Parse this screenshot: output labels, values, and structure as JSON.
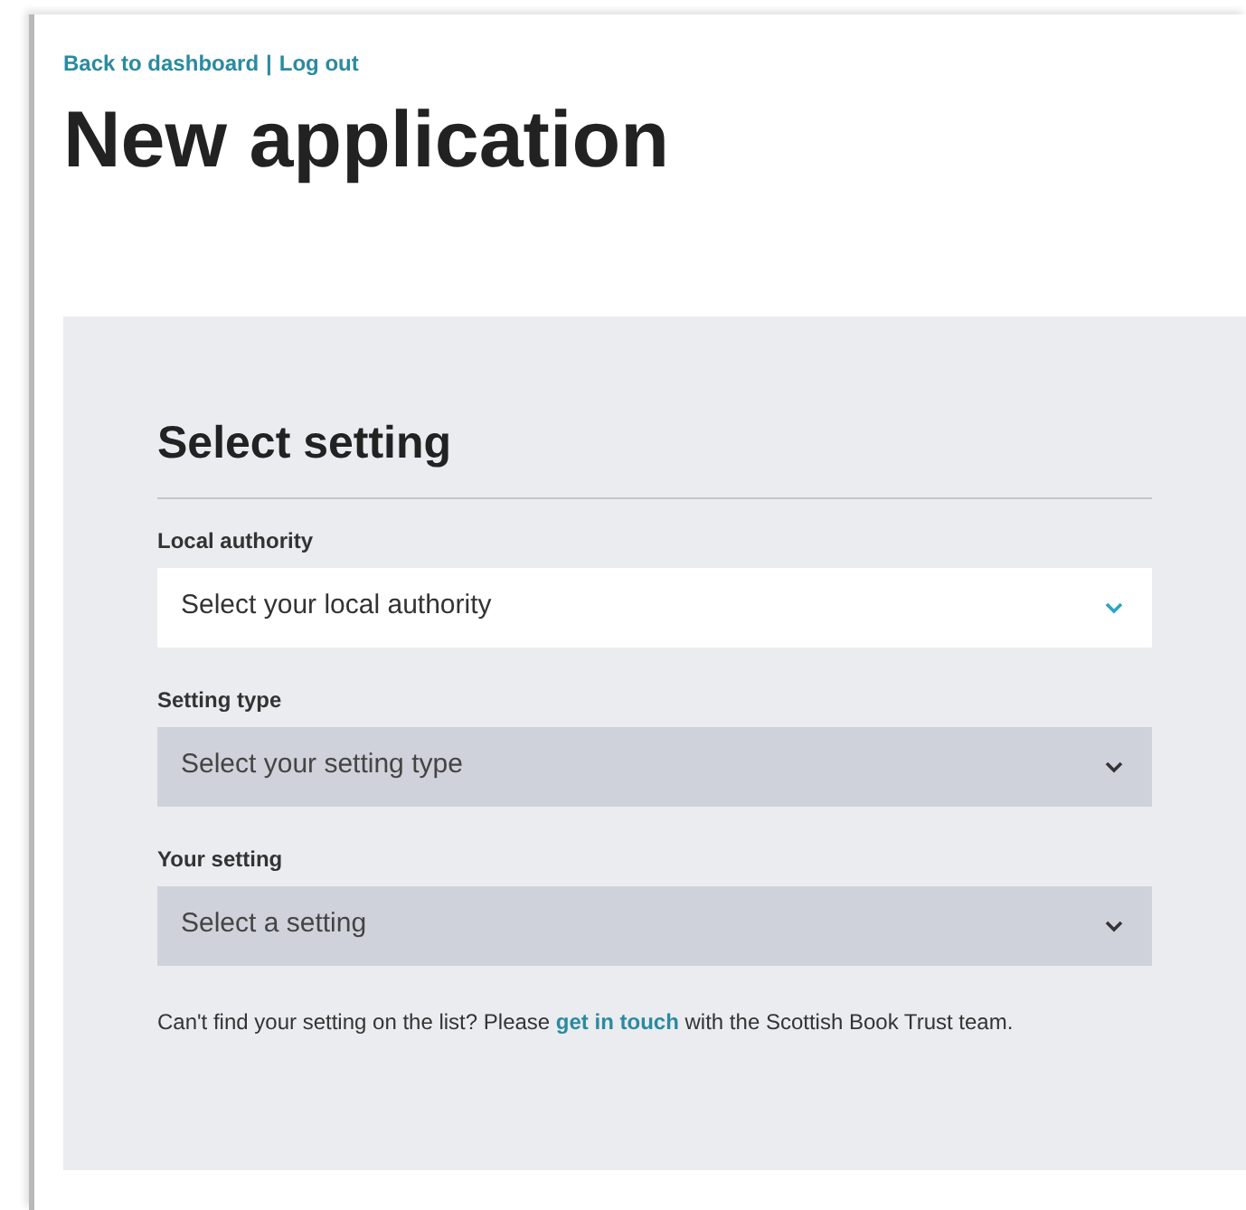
{
  "nav_links": [
    {
      "label": "Back to dashboard"
    },
    {
      "label": "Log out"
    }
  ],
  "nav_separator": "|",
  "page_title": "New application",
  "form": {
    "title": "Select setting",
    "fields": [
      {
        "label": "Local authority",
        "placeholder": "Select your local authority",
        "disabled": false
      },
      {
        "label": "Setting type",
        "placeholder": "Select your setting type",
        "disabled": true
      },
      {
        "label": "Your setting",
        "placeholder": "Select a setting",
        "disabled": true
      }
    ],
    "help_text": {
      "before": "Can't find your setting on the list? Please ",
      "link": "get in touch",
      "after": " with the Scottish Book Trust team."
    }
  }
}
